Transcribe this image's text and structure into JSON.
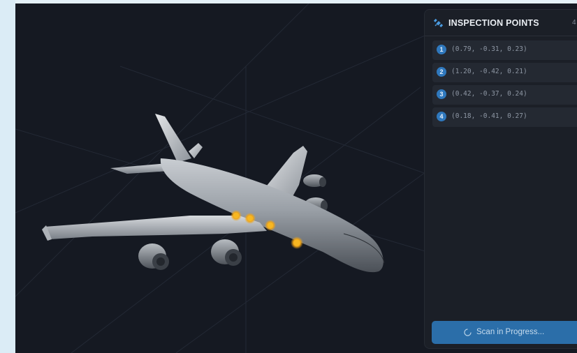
{
  "panel": {
    "title": "INSPECTION POINTS",
    "count": "4",
    "icon": "satellite-icon",
    "items": [
      {
        "number": "1",
        "coords": "(0.79, -0.31, 0.23)"
      },
      {
        "number": "2",
        "coords": "(1.20, -0.42, 0.21)"
      },
      {
        "number": "3",
        "coords": "(0.42, -0.37, 0.24)"
      },
      {
        "number": "4",
        "coords": "(0.18, -0.41, 0.27)"
      }
    ]
  },
  "scan_button": {
    "label": "Scan in Progress...",
    "icon": "spinner-icon"
  },
  "colors": {
    "viewport_bg": "#151922",
    "panel_bg": "#1b1f27",
    "accent": "#2f78bd",
    "marker": "#f0a516",
    "button": "#2b6ea9"
  }
}
